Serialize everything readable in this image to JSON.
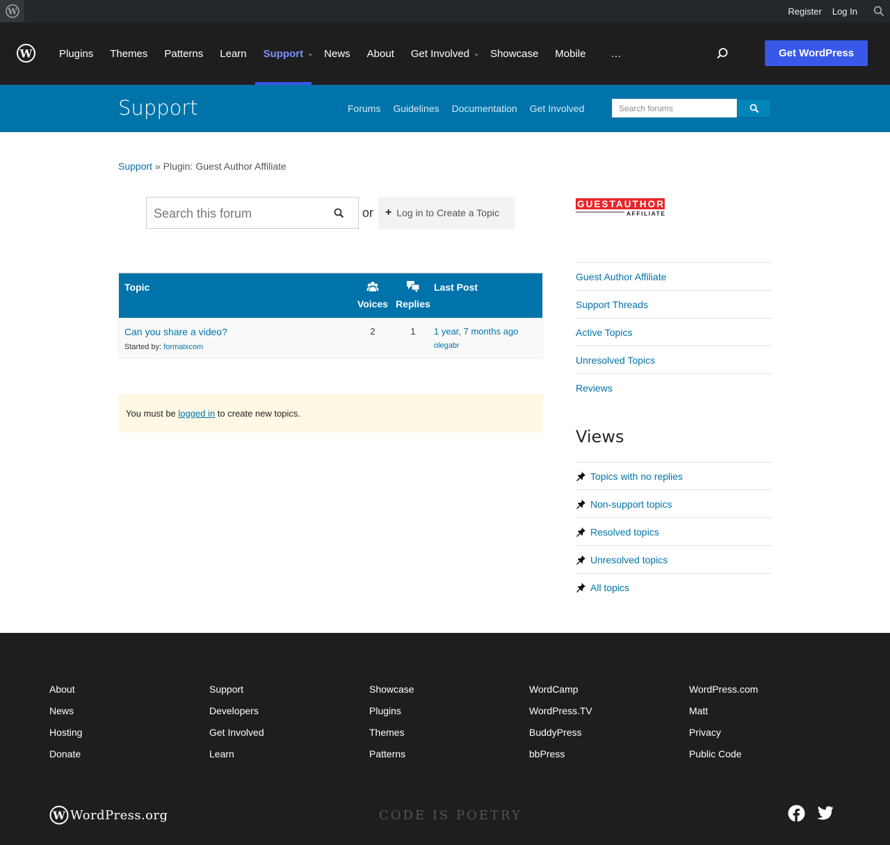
{
  "adminbar": {
    "register": "Register",
    "login": "Log In"
  },
  "gnav": {
    "items": [
      "Plugins",
      "Themes",
      "Patterns",
      "Learn",
      "Support",
      "News",
      "About",
      "Get Involved",
      "Showcase",
      "Mobile",
      "…"
    ],
    "active": "Support",
    "get_wordpress": "Get WordPress"
  },
  "support_header": {
    "title": "Support",
    "nav": [
      "Forums",
      "Guidelines",
      "Documentation",
      "Get Involved"
    ],
    "search_placeholder": "Search forums"
  },
  "breadcrumb": {
    "root": "Support",
    "sep": " » ",
    "current": "Plugin: Guest Author Affiliate"
  },
  "forum_search": {
    "placeholder": "Search this forum",
    "or": "or",
    "create_label": "Log in to Create a Topic"
  },
  "table": {
    "headers": {
      "topic": "Topic",
      "voices": "Voices",
      "replies": "Replies",
      "last_post": "Last Post"
    },
    "rows": [
      {
        "title": "Can you share a video?",
        "started_by_label": "Started by:",
        "author": "formalxcom",
        "voices": "2",
        "replies": "1",
        "last_post": "1 year, 7 months ago",
        "last_author": "olegabr"
      }
    ]
  },
  "notice": {
    "before": "You must be ",
    "link": "logged in",
    "after": " to create new topics."
  },
  "sidebar": {
    "plugin_logo_text": {
      "line1": "GUESTAUTHOR",
      "line2": "AFFILIATE"
    },
    "links": [
      "Guest Author Affiliate",
      "Support Threads",
      "Active Topics",
      "Unresolved Topics",
      "Reviews"
    ],
    "views_title": "Views",
    "views": [
      "Topics with no replies",
      "Non-support topics",
      "Resolved topics",
      "Unresolved topics",
      "All topics"
    ]
  },
  "footer": {
    "columns": [
      [
        "About",
        "News",
        "Hosting",
        "Donate"
      ],
      [
        "Support",
        "Developers",
        "Get Involved",
        "Learn"
      ],
      [
        "Showcase",
        "Plugins",
        "Themes",
        "Patterns"
      ],
      [
        "WordCamp",
        "WordPress.TV",
        "BuddyPress",
        "bbPress"
      ],
      [
        "WordPress.com",
        "Matt",
        "Privacy",
        "Public Code"
      ]
    ],
    "logo_text": "WordPress.org",
    "tagline": "CODE IS POETRY"
  },
  "colors": {
    "header_bg": "#1e1e1e",
    "support_blue": "#0073aa",
    "accent": "#3858e9",
    "notice_bg": "#fff8e5"
  }
}
